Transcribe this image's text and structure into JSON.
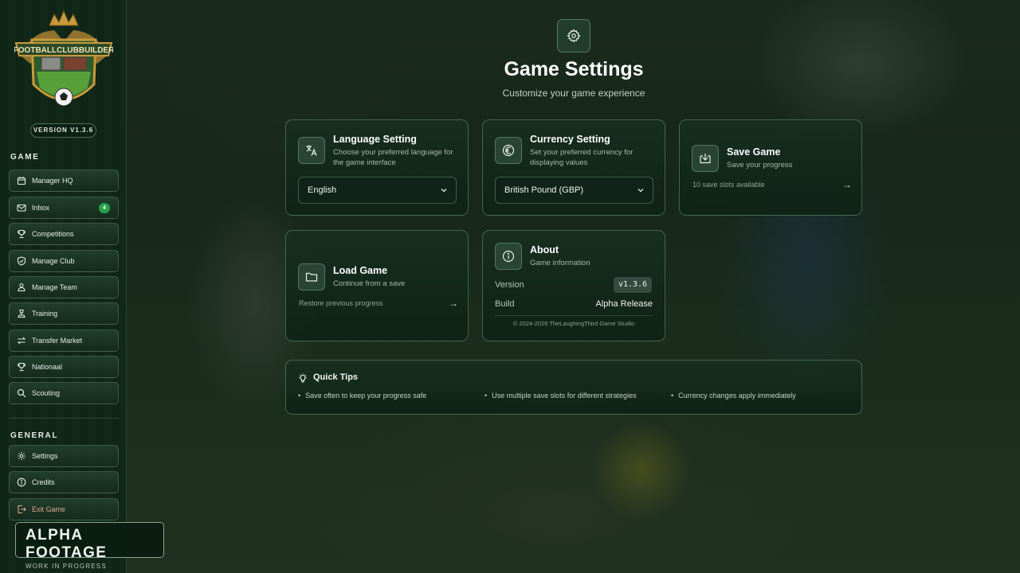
{
  "app": {
    "logo_text": "FOOTBALLCLUBBUILDER",
    "version_label": "VERSION V1.3.6"
  },
  "sidebar": {
    "game_section": "GAME",
    "game_items": [
      {
        "label": "Manager HQ",
        "icon": "calendar-icon"
      },
      {
        "label": "Inbox",
        "icon": "mail-icon",
        "badge": "4"
      },
      {
        "label": "Competitions",
        "icon": "trophy-icon"
      },
      {
        "label": "Manage Club",
        "icon": "shield-icon"
      },
      {
        "label": "Manage Team",
        "icon": "team-icon"
      },
      {
        "label": "Training",
        "icon": "training-icon"
      },
      {
        "label": "Transfer Market",
        "icon": "transfer-icon"
      },
      {
        "label": "Nationaal",
        "icon": "trophy-icon"
      },
      {
        "label": "Scouting",
        "icon": "search-icon"
      }
    ],
    "general_section": "GENERAL",
    "general_items": [
      {
        "label": "Settings",
        "icon": "gear-icon"
      },
      {
        "label": "Credits",
        "icon": "info-icon"
      },
      {
        "label": "Exit Game",
        "icon": "exit-icon"
      }
    ]
  },
  "watermark": {
    "title": "ALPHA FOOTAGE",
    "subtitle": "WORK IN PROGRESS"
  },
  "header": {
    "title": "Game Settings",
    "subtitle": "Customize your game experience"
  },
  "language": {
    "title": "Language Setting",
    "description": "Choose your preferred language for the game interface",
    "selected": "English"
  },
  "currency": {
    "title": "Currency Setting",
    "description": "Set your preferred currency for displaying values",
    "selected": "British Pound (GBP)"
  },
  "save_game": {
    "title": "Save Game",
    "description": "Save your progress",
    "footer": "10 save slots available",
    "arrow": "→"
  },
  "load_game": {
    "title": "Load Game",
    "description": "Continue from a save",
    "footer": "Restore previous progress",
    "arrow": "→"
  },
  "about": {
    "title": "About",
    "description": "Game information",
    "version_label": "Version",
    "version_value": "v1.3.6",
    "build_label": "Build",
    "build_value": "Alpha Release",
    "copyright": "© 2024-2026 TheLaughingThird Game Studio"
  },
  "tips": {
    "title": "Quick Tips",
    "items": [
      "Save often to keep your progress safe",
      "Use multiple save slots for different strategies",
      "Currency changes apply immediately"
    ]
  },
  "colors": {
    "accent": "#25a34a",
    "sidebar_bg": "#0f2516",
    "card_border": "#82aa8c",
    "exit_text": "#e0a792"
  }
}
